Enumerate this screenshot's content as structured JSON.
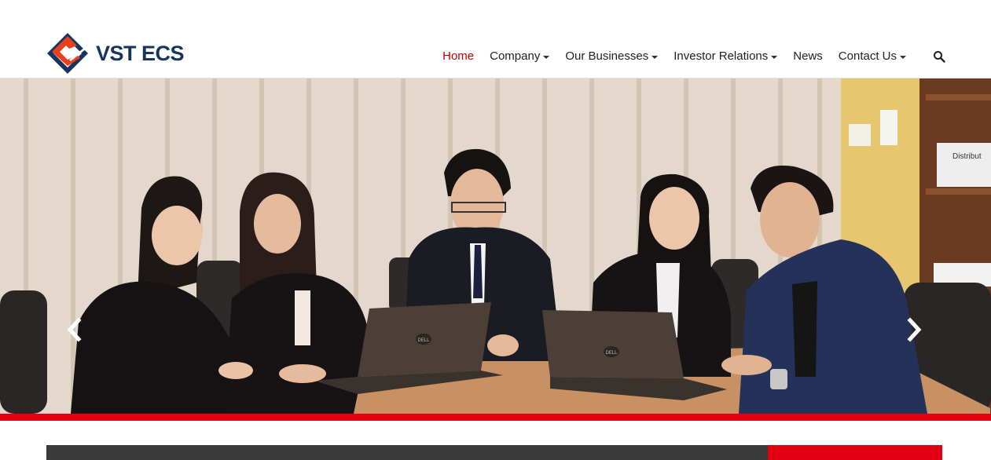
{
  "brand": {
    "name": "VST ECS",
    "colors": {
      "navy": "#17345e",
      "red": "#e60012"
    }
  },
  "nav": {
    "items": [
      {
        "label": "Home",
        "active": true,
        "dropdown": false
      },
      {
        "label": "Company",
        "active": false,
        "dropdown": true
      },
      {
        "label": "Our Businesses",
        "active": false,
        "dropdown": true
      },
      {
        "label": "Investor Relations",
        "active": false,
        "dropdown": true
      },
      {
        "label": "News",
        "active": false,
        "dropdown": false
      },
      {
        "label": "Contact Us",
        "active": false,
        "dropdown": true
      }
    ],
    "search_icon": "search-icon"
  },
  "hero": {
    "image": "team-meeting-photo",
    "prev_icon": "chevron-left-icon",
    "next_icon": "chevron-right-icon",
    "laptop_brand": "DELL",
    "wall_sign": "Distribut"
  }
}
